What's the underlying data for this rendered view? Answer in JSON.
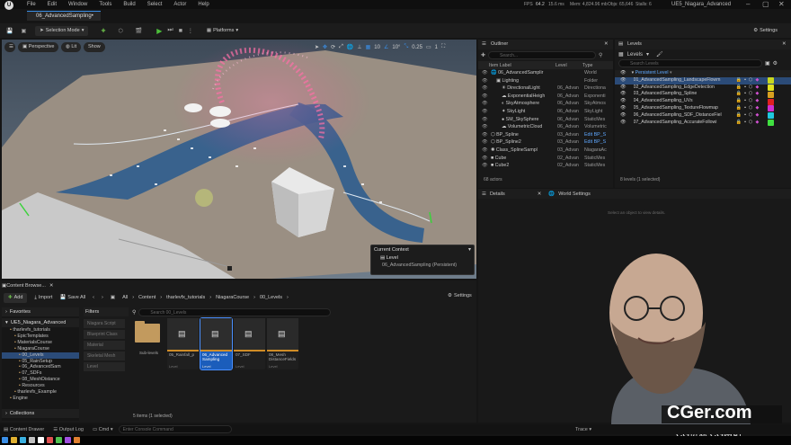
{
  "menu": {
    "items": [
      "File",
      "Edit",
      "Window",
      "Tools",
      "Build",
      "Select",
      "Actor",
      "Help"
    ]
  },
  "window": {
    "title": "UE5_Niagara_Advanced",
    "tab": "06_AdvancedSampling•"
  },
  "stats": {
    "fps_label": "FPS",
    "fps": "64.2",
    "ms": "15.6 ms",
    "mem": "Mem: 4,824.96 mb",
    "objs": "Objs: 65,646",
    "stalls": "Stalls: 6"
  },
  "toolbar": {
    "mode": "Selection Mode",
    "platforms": "Platforms",
    "settings": "Settings"
  },
  "viewport": {
    "perspective": "Perspective",
    "lit": "Lit",
    "show": "Show",
    "snap_grid": "10",
    "snap_angle": "10°",
    "snap_scale": "0.25",
    "camera_speed": "1",
    "context_title": "Current Context",
    "context_level_label": "Level",
    "context_level": "06_AdvancedSampling (Persistent)"
  },
  "outliner": {
    "title": "Outliner",
    "search_placeholder": "Search...",
    "col_label": "Item Label",
    "col_level": "Level",
    "col_type": "Type",
    "rows": [
      {
        "label": "06_AdvancedSamplir",
        "level": "",
        "type": "World"
      },
      {
        "label": "Lighting",
        "level": "",
        "type": "Folder"
      },
      {
        "label": "DirectionalLight",
        "level": "06_Advan",
        "type": "Directiona"
      },
      {
        "label": "ExponentialHeigh",
        "level": "06_Advan",
        "type": "Exponenti"
      },
      {
        "label": "SkyAtmosphere",
        "level": "06_Advan",
        "type": "SkyAtmos"
      },
      {
        "label": "SkyLight",
        "level": "06_Advan",
        "type": "SkyLight"
      },
      {
        "label": "SM_SkySphere",
        "level": "06_Advan",
        "type": "StaticMes"
      },
      {
        "label": "VolumetricCloud",
        "level": "06_Advan",
        "type": "Volumetric"
      },
      {
        "label": "BP_Spline",
        "level": "03_Advan",
        "type": "Edit BP_S"
      },
      {
        "label": "BP_Spline2",
        "level": "03_Advan",
        "type": "Edit BP_S"
      },
      {
        "label": "Class_SplineSampl",
        "level": "03_Advan",
        "type": "NiagaraAc"
      },
      {
        "label": "Cube",
        "level": "02_Advan",
        "type": "StaticMes"
      },
      {
        "label": "Cube2",
        "level": "02_Advan",
        "type": "StaticMes"
      }
    ],
    "footer": "68 actors"
  },
  "levels": {
    "title": "Levels",
    "dropdown": "Levels",
    "search_placeholder": "Search Levels",
    "persistent": "Persistent Level",
    "items": [
      {
        "name": "01_AdvancedSampling_LandscapeFlowm",
        "color": "#c8d820"
      },
      {
        "name": "02_AdvancedSampling_EdgeDetection",
        "color": "#e0e020"
      },
      {
        "name": "03_AdvancedSampling_Spline",
        "color": "#d8a020"
      },
      {
        "name": "04_AdvancedSampling_UVs",
        "color": "#e02020"
      },
      {
        "name": "05_AdvancedSampling_TextureFlowmap",
        "color": "#d030d0"
      },
      {
        "name": "06_AdvancedSampling_SDF_DistanceFiel",
        "color": "#20c8e0"
      },
      {
        "name": "07_AdvancedSampling_AccurateFollowi",
        "color": "#40e040"
      }
    ],
    "footer": "8 levels (1 selected)"
  },
  "details": {
    "tab1": "Details",
    "tab2": "World Settings",
    "empty": "Select an object to view details."
  },
  "content_browser": {
    "title": "Content Browse...",
    "add": "Add",
    "import": "Import",
    "save_all": "Save All",
    "path": [
      "All",
      "Content",
      "tharlevfx_tutorials",
      "NiagaraCourse",
      "00_Levels"
    ],
    "settings": "Settings",
    "favorites": "Favorites",
    "project": "UE5_Niagara_Advanced",
    "tree": [
      {
        "label": "tharlevfx_tutorials",
        "depth": 1
      },
      {
        "label": "EpicTemplates",
        "depth": 2
      },
      {
        "label": "MaterialsCourse",
        "depth": 2
      },
      {
        "label": "NiagaraCourse",
        "depth": 2
      },
      {
        "label": "00_Levels",
        "depth": 3,
        "selected": true
      },
      {
        "label": "05_RainSetup",
        "depth": 3
      },
      {
        "label": "06_AdvancedSam",
        "depth": 3
      },
      {
        "label": "07_SDFs",
        "depth": 3
      },
      {
        "label": "08_MeshDistance",
        "depth": 3
      },
      {
        "label": "Resources",
        "depth": 3
      },
      {
        "label": "tharlevfx_Example",
        "depth": 2
      },
      {
        "label": "Engine",
        "depth": 1
      }
    ],
    "collections": "Collections",
    "filters_title": "Filters",
    "filters": [
      "Niagara Script",
      "Blueprint Class",
      "Material",
      "Skeletal Mesh",
      "Level"
    ],
    "search_placeholder": "Search 00_Levels",
    "folder_name": "Sub-levels",
    "assets": [
      {
        "name": "05_Rainfall_p",
        "type": "Level"
      },
      {
        "name": "06_Advanced Sampling",
        "type": "Level",
        "selected": true
      },
      {
        "name": "07_SDF",
        "type": "Level"
      },
      {
        "name": "08_Mesh DistanceFields",
        "type": "Level"
      }
    ],
    "status": "5 items (1 selected)"
  },
  "bottom": {
    "drawer": "Content Drawer",
    "output": "Output Log",
    "cmd": "Cmd",
    "console_placeholder": "Enter Console Command",
    "trace": "Trace"
  },
  "watermark": {
    "main": "CGer.com",
    "sub": "CG资源 CG网站"
  }
}
